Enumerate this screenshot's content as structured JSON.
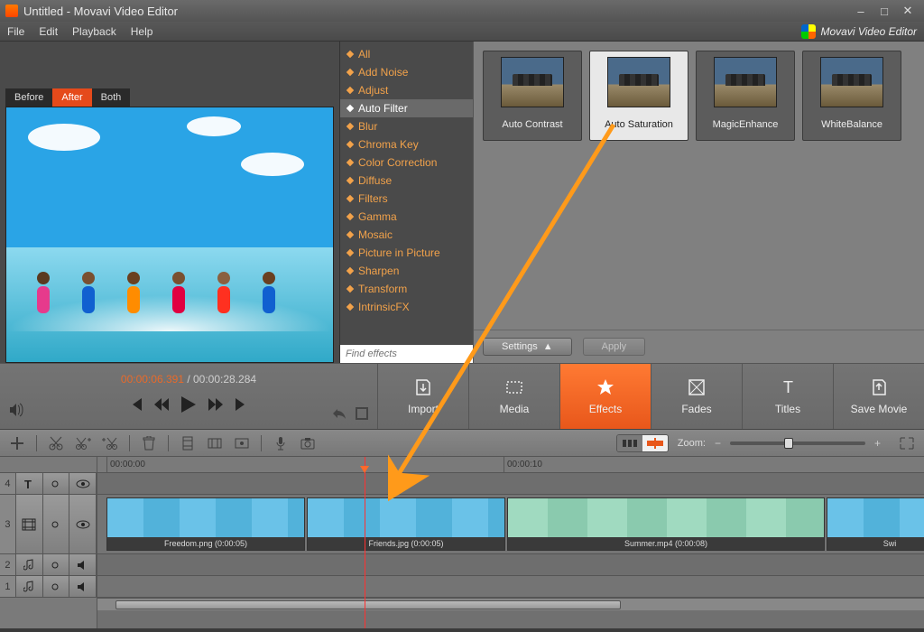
{
  "title": "Untitled - Movavi Video Editor",
  "brand": "Movavi Video Editor",
  "menus": {
    "file": "File",
    "edit": "Edit",
    "playback": "Playback",
    "help": "Help"
  },
  "preview_tabs": {
    "before": "Before",
    "after": "After",
    "both": "Both",
    "active": "after"
  },
  "effects_list": {
    "items": [
      "All",
      "Add Noise",
      "Adjust",
      "Auto Filter",
      "Blur",
      "Chroma Key",
      "Color Correction",
      "Diffuse",
      "Filters",
      "Gamma",
      "Mosaic",
      "Picture in Picture",
      "Sharpen",
      "Transform",
      "IntrinsicFX"
    ],
    "selected_index": 3,
    "find_placeholder": "Find effects"
  },
  "effect_thumbs": {
    "items": [
      "Auto Contrast",
      "Auto Saturation",
      "MagicEnhance",
      "WhiteBalance"
    ],
    "selected_index": 1,
    "settings_btn": "Settings",
    "apply_btn": "Apply"
  },
  "transport": {
    "current": "00:00:06.391",
    "separator": " / ",
    "duration": "00:00:28.284"
  },
  "mode_buttons": {
    "items": [
      "Import",
      "Media",
      "Effects",
      "Fades",
      "Titles",
      "Save Movie"
    ],
    "active_index": 2
  },
  "zoom_label": "Zoom:",
  "ruler": {
    "t0": "00:00:00",
    "t1": "00:00:10"
  },
  "tracks": {
    "t4_num": "4",
    "t3_num": "3",
    "t2_num": "2",
    "t1_num": "1"
  },
  "clips": [
    {
      "label": "Freedom.png (0:00:05)"
    },
    {
      "label": "Friends.jpg (0:00:05)"
    },
    {
      "label": "Summer.mp4 (0:00:08)"
    },
    {
      "label": "Swi"
    }
  ],
  "win": {
    "min": "–",
    "max": "□",
    "close": "✕"
  }
}
